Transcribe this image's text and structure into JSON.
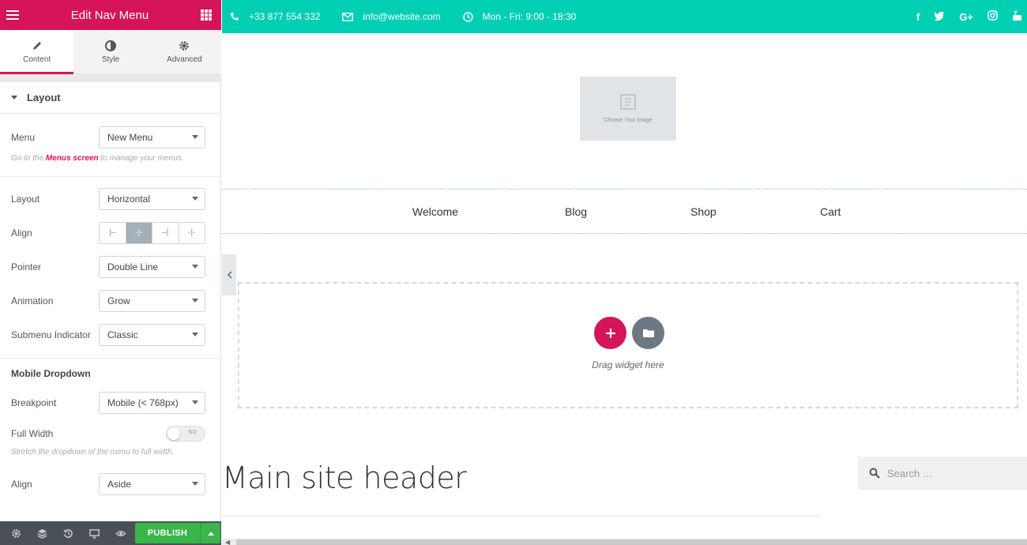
{
  "panel": {
    "title": "Edit Nav Menu",
    "tabs": [
      {
        "label": "Content",
        "icon": "pencil-icon"
      },
      {
        "label": "Style",
        "icon": "half-circle-icon"
      },
      {
        "label": "Advanced",
        "icon": "gear-icon"
      }
    ],
    "section_title": "Layout",
    "menu": {
      "label": "Menu",
      "value": "New Menu"
    },
    "menu_hint": {
      "prefix": "Go to the ",
      "link": "Menus screen",
      "suffix": " to manage your menus."
    },
    "layout": {
      "label": "Layout",
      "value": "Horizontal"
    },
    "align": {
      "label": "Align"
    },
    "pointer": {
      "label": "Pointer",
      "value": "Double Line"
    },
    "animation": {
      "label": "Animation",
      "value": "Grow"
    },
    "submenu_indicator": {
      "label": "Submenu Indicator",
      "value": "Classic"
    },
    "mobile_dropdown": {
      "title": "Mobile Dropdown"
    },
    "breakpoint": {
      "label": "Breakpoint",
      "value": "Mobile (< 768px)"
    },
    "full_width": {
      "label": "Full Width",
      "toggle_text": "NO",
      "hint": "Stretch the dropdown of the menu to full width."
    },
    "mobile_align": {
      "label": "Align",
      "value": "Aside"
    },
    "footer": {
      "publish_label": "PUBLISH"
    },
    "colors": {
      "accent": "#d5145a",
      "publish": "#39b54a",
      "footer_bg": "#495157"
    }
  },
  "topbar": {
    "phone": "+33 877 554 332",
    "email": "info@website.com",
    "hours": "Mon - Fri: 9:00 - 18:30",
    "social": [
      "f",
      "t",
      "G+",
      "ig",
      "yt"
    ],
    "bg_color": "#00cfb4"
  },
  "logo": {
    "placeholder_text": "Choose Your Image"
  },
  "nav": {
    "items": [
      "Welcome",
      "Blog",
      "Shop",
      "Cart"
    ]
  },
  "dropzone": {
    "text": "Drag widget here"
  },
  "site": {
    "header_title": "Main site header",
    "search_placeholder": "Search …"
  }
}
